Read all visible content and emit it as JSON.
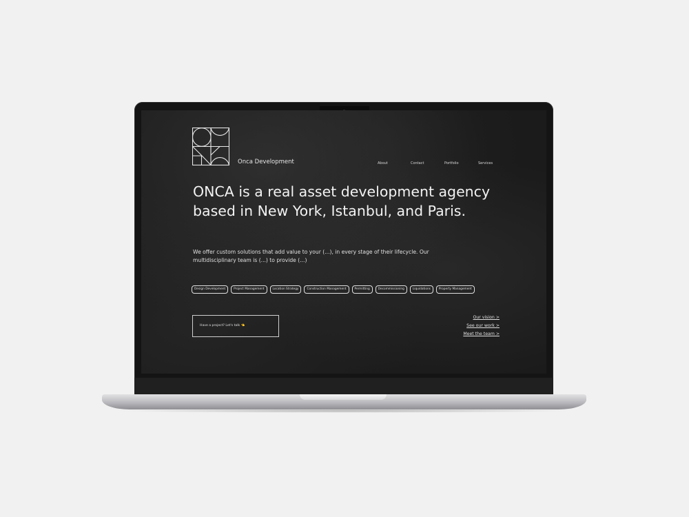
{
  "site": {
    "brand": "Onca Development",
    "nav": [
      "About",
      "Contact",
      "Portfolio",
      "Services"
    ],
    "headline": "ONCA is a real asset development agency based in New York, Istanbul, and Paris.",
    "intro": "We offer custom solutions that add value to your (...), in every stage of their lifecycle. Our multidisciplinary team is (...) to provide (...)",
    "tags": [
      "Design Development",
      "Project Management",
      "Location Strategy",
      "Construction Management",
      "Permitting",
      "Decommissioning",
      "Liquidations",
      "Property Management"
    ],
    "cta": "Have a project? Let's talk 👈",
    "links": [
      "Our vision >",
      "See our work >",
      "Meet the team >"
    ]
  },
  "colors": {
    "desk": "#f1f1f1",
    "screen_bg": "#1b1b1b",
    "text": "#f2f2f2",
    "cta_emoji": "#e0a53b"
  }
}
